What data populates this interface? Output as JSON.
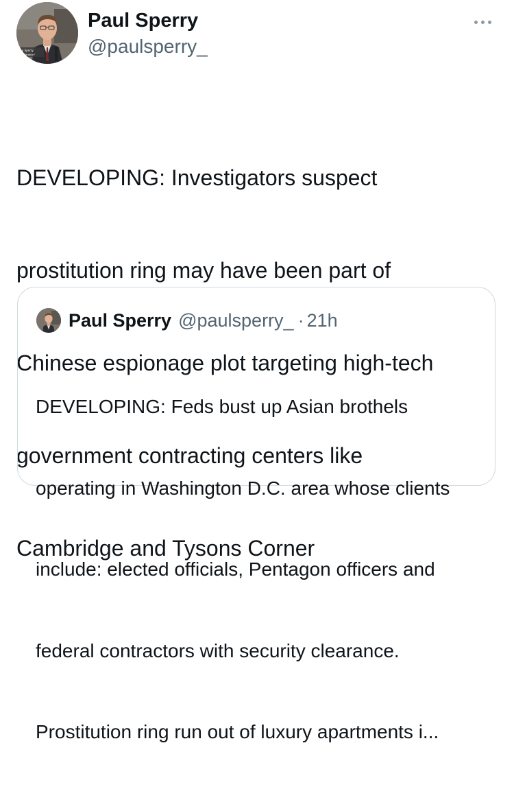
{
  "tweet": {
    "author": {
      "display_name": "Paul Sperry",
      "handle": "@paulsperry_",
      "avatar_icon": "profile-photo-icon",
      "avatar_caption_line1": "Paul Sperry",
      "avatar_caption_line2": "\"Infiltration\""
    },
    "more_icon": "more-horizontal-icon",
    "text_lines": [
      "DEVELOPING: Investigators suspect",
      "prostitution ring may have been part of",
      "Chinese espionage plot targeting high-tech",
      "government contracting centers like",
      "Cambridge and Tysons Corner"
    ],
    "quoted": {
      "display_name": "Paul Sperry",
      "handle": "@paulsperry_",
      "separator": "·",
      "time": "21h",
      "avatar_icon": "profile-photo-icon",
      "text_lines": [
        "DEVELOPING: Feds bust up Asian brothels",
        "operating in Washington D.C. area whose clients",
        "include: elected officials, Pentagon officers and",
        "federal contractors with security clearance.",
        "Prostitution ring run out of luxury apartments i..."
      ]
    }
  },
  "colors": {
    "text_primary": "#0f1419",
    "text_secondary": "#536471",
    "card_border": "#cfd9de",
    "background": "#ffffff"
  }
}
